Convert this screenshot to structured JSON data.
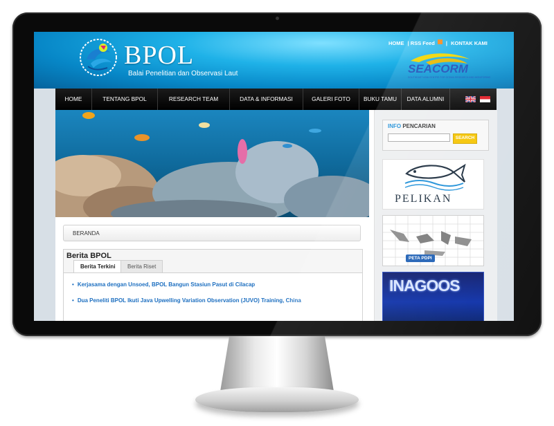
{
  "site": {
    "logo_title": "BPOL",
    "logo_subtitle": "Balai Penelitian dan Observasi Laut",
    "partner_logo": "SEACORM",
    "partner_tagline": "SOUTHEAST ASIA CENTRE FOR OCEAN RESEARCH AND MONITORING"
  },
  "toplinks": {
    "home": "HOME",
    "rss": "| RSS Feed",
    "sep": "|",
    "contact": "KONTAK KAMI"
  },
  "nav": {
    "items": [
      "HOME",
      "TENTANG BPOL",
      "RESEARCH TEAM",
      "DATA & INFORMASI",
      "GALERI FOTO",
      "BUKU TAMU",
      "DATA ALUMNI"
    ],
    "flags": [
      "uk-flag-icon",
      "indonesia-flag-icon"
    ]
  },
  "breadcrumb": "BERANDA",
  "berita": {
    "title": "Berita BPOL",
    "tabs": [
      "Berita Terkini",
      "Berita Riset"
    ],
    "items": [
      "Kerjasama dengan Unsoed, BPOL Bangun Stasiun Pasut di Cilacap",
      "Dua Peneliti BPOL Ikuti Java Upwelling Variation Observation (JUVO) Training, China"
    ]
  },
  "sidebar": {
    "search_title_hl": "INFO",
    "search_title": " PENCARIAN",
    "search_value": "",
    "search_button": "SEARCH",
    "pelikan_label": "PELIKAN",
    "peta_label": "PETA PDPI",
    "inagoos_label": "INAGOOS"
  },
  "colors": {
    "header_blue": "#1fb2e8",
    "nav_black": "#000000",
    "link_blue": "#1d6fc0",
    "search_yellow": "#f5c400"
  }
}
